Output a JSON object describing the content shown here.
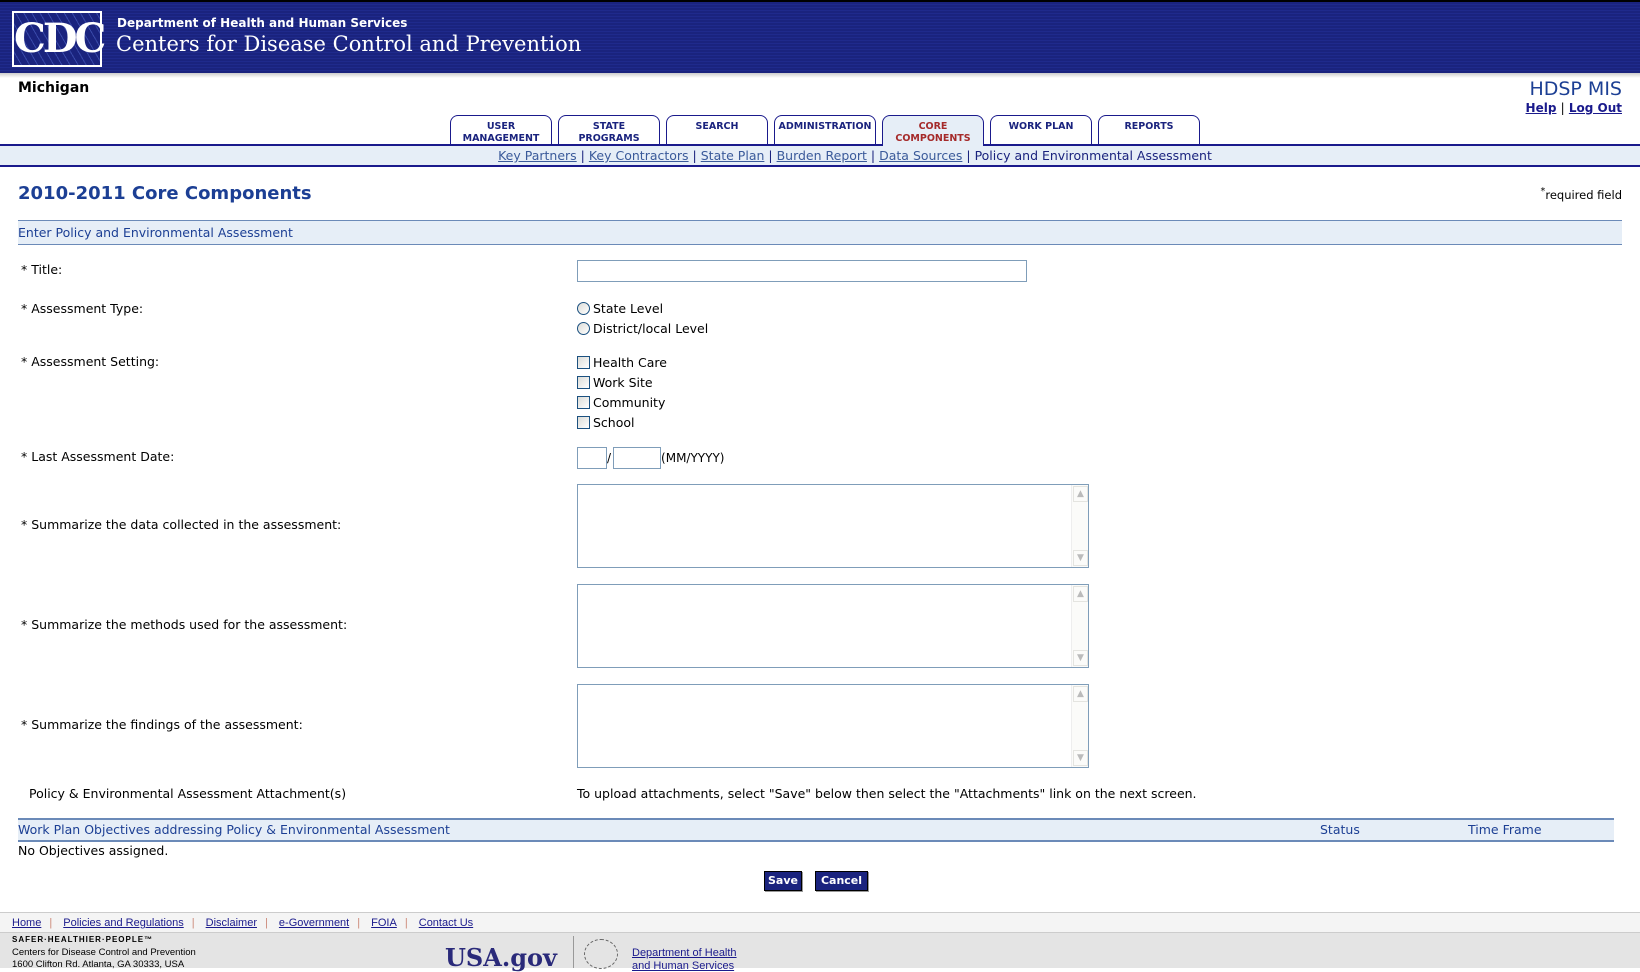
{
  "header": {
    "logo_text": "CDC",
    "department": "Department of Health and Human Services",
    "agency": "Centers for Disease Control and Prevention"
  },
  "state": "Michigan",
  "app_title": "HDSP MIS",
  "user_links": {
    "help": "Help",
    "separator": "|",
    "logout": "Log Out"
  },
  "tabs": [
    {
      "line1": "USER",
      "line2": "MANAGEMENT"
    },
    {
      "line1": "STATE",
      "line2": "PROGRAMS"
    },
    {
      "line1": "SEARCH",
      "line2": ""
    },
    {
      "line1": "ADMINISTRATION",
      "line2": ""
    },
    {
      "line1": "CORE",
      "line2": "COMPONENTS"
    },
    {
      "line1": "WORK PLAN",
      "line2": ""
    },
    {
      "line1": "REPORTS",
      "line2": ""
    }
  ],
  "subnav": [
    "Key Partners",
    "Key Contractors",
    "State Plan",
    "Burden Report",
    "Data Sources",
    "Policy and Environmental Assessment"
  ],
  "page_title": "2010-2011 Core Components",
  "required_note": {
    "star": "*",
    "text": "required field"
  },
  "section_title": "Enter Policy and Environmental Assessment",
  "form": {
    "title_label": "* Title:",
    "title_value": "",
    "type_label": "* Assessment Type:",
    "type_options": [
      "State Level",
      "District/local Level"
    ],
    "setting_label": "* Assessment Setting:",
    "setting_options": [
      "Health Care",
      "Work Site",
      "Community",
      "School"
    ],
    "date_label": "* Last Assessment Date:",
    "date_sep": "/",
    "date_hint": "(MM/YYYY)",
    "data_label": "* Summarize the data collected in the assessment:",
    "methods_label": "* Summarize the methods used for the assessment:",
    "findings_label": "* Summarize the findings of the assessment:",
    "attach_label": "Policy & Environmental Assessment Attachment(s)",
    "attach_note": "To upload attachments, select \"Save\" below then select the \"Attachments\" link on the next screen."
  },
  "objectives": {
    "header": "Work Plan Objectives addressing Policy & Environmental Assessment",
    "status": "Status",
    "time_frame": "Time Frame",
    "empty": "No Objectives assigned."
  },
  "buttons": {
    "save": "Save",
    "cancel": "Cancel"
  },
  "footer": {
    "links": [
      "Home",
      "Policies and Regulations",
      "Disclaimer",
      "e-Government",
      "FOIA",
      "Contact Us"
    ],
    "tagline": "SAFER·HEALTHIER·PEOPLE™",
    "org": "Centers for Disease Control and Prevention",
    "address": "1600 Clifton Rd. Atlanta, GA 30333, USA",
    "usagov": "USA.gov",
    "hhs_line1": "Department of Health",
    "hhs_line2": "and Human Services"
  }
}
